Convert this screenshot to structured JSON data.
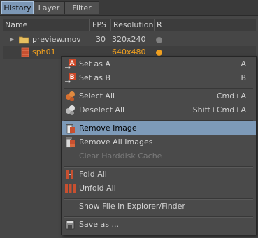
{
  "tabs": [
    "History",
    "Layer",
    "Filter"
  ],
  "columns": [
    "Name",
    "FPS",
    "Resolution",
    "R"
  ],
  "rows": [
    {
      "name": "preview.mov",
      "fps": "30",
      "resolution": "320x240",
      "status_color": "#808080"
    },
    {
      "name": "sph01",
      "fps": "",
      "resolution": "640x480",
      "status_color": "#f0a020"
    }
  ],
  "menu": {
    "items": [
      {
        "label": "Set as A",
        "shortcut": "A",
        "icon": "set-a-icon"
      },
      {
        "label": "Set as B",
        "shortcut": "B",
        "icon": "set-b-icon"
      },
      {
        "label": "Select All",
        "shortcut": "Cmd+A",
        "icon": "select-all-icon"
      },
      {
        "label": "Deselect All",
        "shortcut": "Shift+Cmd+A",
        "icon": "deselect-all-icon"
      },
      {
        "label": "Remove Image",
        "shortcut": "",
        "icon": "remove-image-icon"
      },
      {
        "label": "Remove All Images",
        "shortcut": "",
        "icon": "remove-all-images-icon"
      },
      {
        "label": "Clear Harddisk Cache",
        "shortcut": "",
        "icon": ""
      },
      {
        "label": "Fold All",
        "shortcut": "",
        "icon": "fold-all-icon"
      },
      {
        "label": "Unfold All",
        "shortcut": "",
        "icon": "unfold-all-icon"
      },
      {
        "label": "Show File in Explorer/Finder",
        "shortcut": "",
        "icon": ""
      },
      {
        "label": "Save as ...",
        "shortcut": "",
        "icon": "save-icon"
      }
    ]
  },
  "colors": {
    "accent_highlight": "#7d9ab8",
    "active_row_text": "#f0a020"
  }
}
